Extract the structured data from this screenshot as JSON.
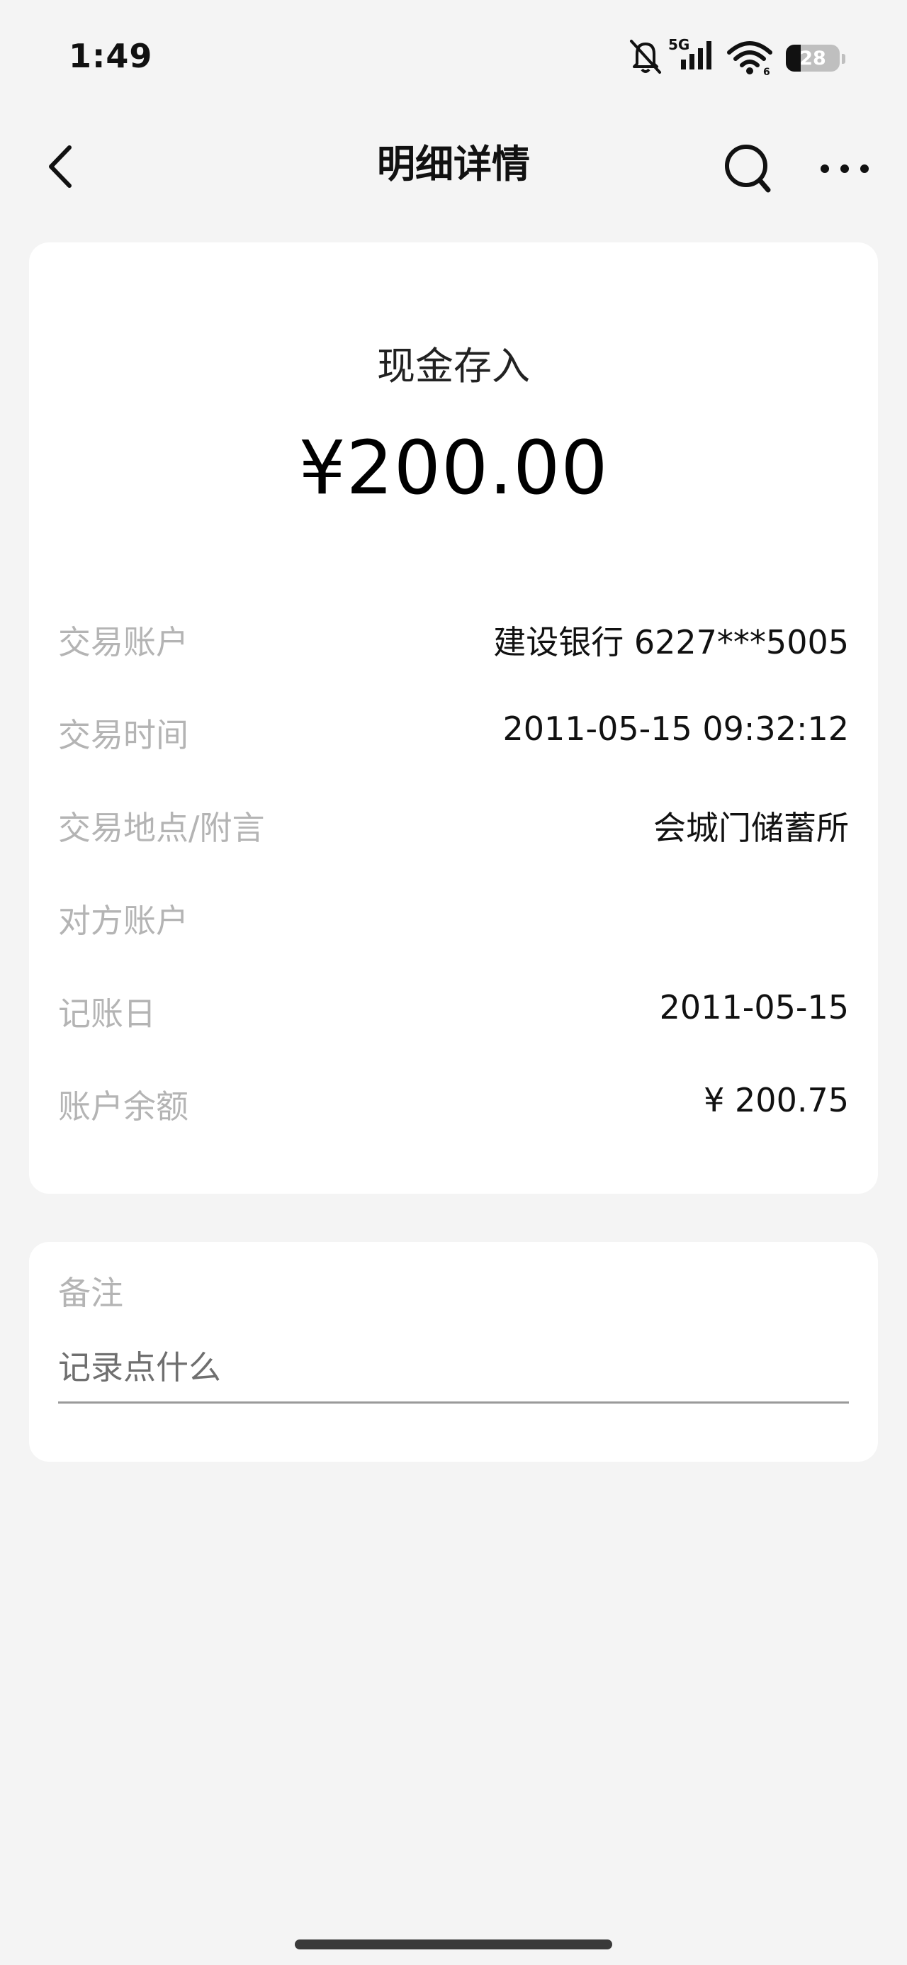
{
  "status_bar": {
    "time": "1:49",
    "network": "5G",
    "battery_level": "28",
    "icons": [
      "mute-icon",
      "signal-icon",
      "wifi-icon",
      "battery-icon"
    ]
  },
  "header": {
    "title": "明细详情",
    "icons": [
      "back-icon",
      "search-icon",
      "more-icon"
    ]
  },
  "transaction": {
    "type": "现金存入",
    "amount": "¥200.00",
    "details": [
      {
        "label": "交易账户",
        "value": "建设银行 6227***5005"
      },
      {
        "label": "交易时间",
        "value": "2011-05-15 09:32:12"
      },
      {
        "label": "交易地点/附言",
        "value": "会城门储蓄所"
      },
      {
        "label": "对方账户",
        "value": ""
      },
      {
        "label": "记账日",
        "value": "2011-05-15"
      },
      {
        "label": "账户余额",
        "value": "¥ 200.75"
      }
    ]
  },
  "note": {
    "label": "备注",
    "placeholder": "记录点什么"
  },
  "colors": {
    "background": "#f4f4f4",
    "card": "#ffffff",
    "label": "#b4b4b4",
    "text": "#111111"
  }
}
